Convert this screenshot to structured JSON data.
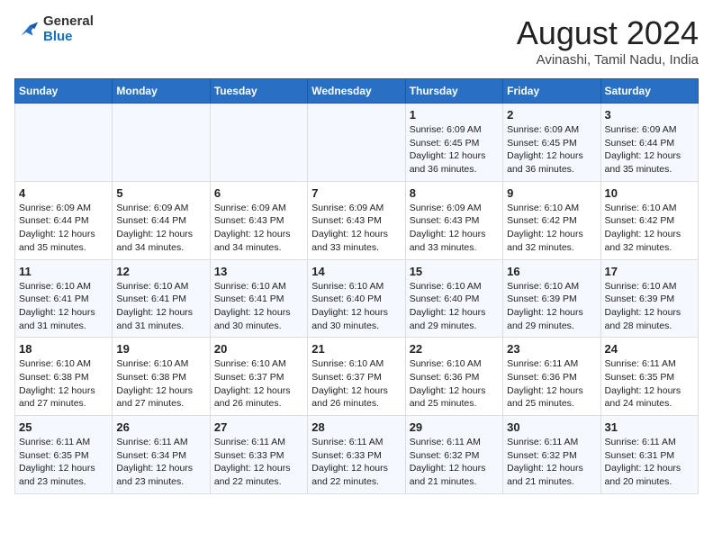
{
  "header": {
    "logo_line1": "General",
    "logo_line2": "Blue",
    "month_title": "August 2024",
    "location": "Avinashi, Tamil Nadu, India"
  },
  "weekdays": [
    "Sunday",
    "Monday",
    "Tuesday",
    "Wednesday",
    "Thursday",
    "Friday",
    "Saturday"
  ],
  "weeks": [
    [
      {
        "day": "",
        "info": ""
      },
      {
        "day": "",
        "info": ""
      },
      {
        "day": "",
        "info": ""
      },
      {
        "day": "",
        "info": ""
      },
      {
        "day": "1",
        "info": "Sunrise: 6:09 AM\nSunset: 6:45 PM\nDaylight: 12 hours\nand 36 minutes."
      },
      {
        "day": "2",
        "info": "Sunrise: 6:09 AM\nSunset: 6:45 PM\nDaylight: 12 hours\nand 36 minutes."
      },
      {
        "day": "3",
        "info": "Sunrise: 6:09 AM\nSunset: 6:44 PM\nDaylight: 12 hours\nand 35 minutes."
      }
    ],
    [
      {
        "day": "4",
        "info": "Sunrise: 6:09 AM\nSunset: 6:44 PM\nDaylight: 12 hours\nand 35 minutes."
      },
      {
        "day": "5",
        "info": "Sunrise: 6:09 AM\nSunset: 6:44 PM\nDaylight: 12 hours\nand 34 minutes."
      },
      {
        "day": "6",
        "info": "Sunrise: 6:09 AM\nSunset: 6:43 PM\nDaylight: 12 hours\nand 34 minutes."
      },
      {
        "day": "7",
        "info": "Sunrise: 6:09 AM\nSunset: 6:43 PM\nDaylight: 12 hours\nand 33 minutes."
      },
      {
        "day": "8",
        "info": "Sunrise: 6:09 AM\nSunset: 6:43 PM\nDaylight: 12 hours\nand 33 minutes."
      },
      {
        "day": "9",
        "info": "Sunrise: 6:10 AM\nSunset: 6:42 PM\nDaylight: 12 hours\nand 32 minutes."
      },
      {
        "day": "10",
        "info": "Sunrise: 6:10 AM\nSunset: 6:42 PM\nDaylight: 12 hours\nand 32 minutes."
      }
    ],
    [
      {
        "day": "11",
        "info": "Sunrise: 6:10 AM\nSunset: 6:41 PM\nDaylight: 12 hours\nand 31 minutes."
      },
      {
        "day": "12",
        "info": "Sunrise: 6:10 AM\nSunset: 6:41 PM\nDaylight: 12 hours\nand 31 minutes."
      },
      {
        "day": "13",
        "info": "Sunrise: 6:10 AM\nSunset: 6:41 PM\nDaylight: 12 hours\nand 30 minutes."
      },
      {
        "day": "14",
        "info": "Sunrise: 6:10 AM\nSunset: 6:40 PM\nDaylight: 12 hours\nand 30 minutes."
      },
      {
        "day": "15",
        "info": "Sunrise: 6:10 AM\nSunset: 6:40 PM\nDaylight: 12 hours\nand 29 minutes."
      },
      {
        "day": "16",
        "info": "Sunrise: 6:10 AM\nSunset: 6:39 PM\nDaylight: 12 hours\nand 29 minutes."
      },
      {
        "day": "17",
        "info": "Sunrise: 6:10 AM\nSunset: 6:39 PM\nDaylight: 12 hours\nand 28 minutes."
      }
    ],
    [
      {
        "day": "18",
        "info": "Sunrise: 6:10 AM\nSunset: 6:38 PM\nDaylight: 12 hours\nand 27 minutes."
      },
      {
        "day": "19",
        "info": "Sunrise: 6:10 AM\nSunset: 6:38 PM\nDaylight: 12 hours\nand 27 minutes."
      },
      {
        "day": "20",
        "info": "Sunrise: 6:10 AM\nSunset: 6:37 PM\nDaylight: 12 hours\nand 26 minutes."
      },
      {
        "day": "21",
        "info": "Sunrise: 6:10 AM\nSunset: 6:37 PM\nDaylight: 12 hours\nand 26 minutes."
      },
      {
        "day": "22",
        "info": "Sunrise: 6:10 AM\nSunset: 6:36 PM\nDaylight: 12 hours\nand 25 minutes."
      },
      {
        "day": "23",
        "info": "Sunrise: 6:11 AM\nSunset: 6:36 PM\nDaylight: 12 hours\nand 25 minutes."
      },
      {
        "day": "24",
        "info": "Sunrise: 6:11 AM\nSunset: 6:35 PM\nDaylight: 12 hours\nand 24 minutes."
      }
    ],
    [
      {
        "day": "25",
        "info": "Sunrise: 6:11 AM\nSunset: 6:35 PM\nDaylight: 12 hours\nand 23 minutes."
      },
      {
        "day": "26",
        "info": "Sunrise: 6:11 AM\nSunset: 6:34 PM\nDaylight: 12 hours\nand 23 minutes."
      },
      {
        "day": "27",
        "info": "Sunrise: 6:11 AM\nSunset: 6:33 PM\nDaylight: 12 hours\nand 22 minutes."
      },
      {
        "day": "28",
        "info": "Sunrise: 6:11 AM\nSunset: 6:33 PM\nDaylight: 12 hours\nand 22 minutes."
      },
      {
        "day": "29",
        "info": "Sunrise: 6:11 AM\nSunset: 6:32 PM\nDaylight: 12 hours\nand 21 minutes."
      },
      {
        "day": "30",
        "info": "Sunrise: 6:11 AM\nSunset: 6:32 PM\nDaylight: 12 hours\nand 21 minutes."
      },
      {
        "day": "31",
        "info": "Sunrise: 6:11 AM\nSunset: 6:31 PM\nDaylight: 12 hours\nand 20 minutes."
      }
    ]
  ]
}
